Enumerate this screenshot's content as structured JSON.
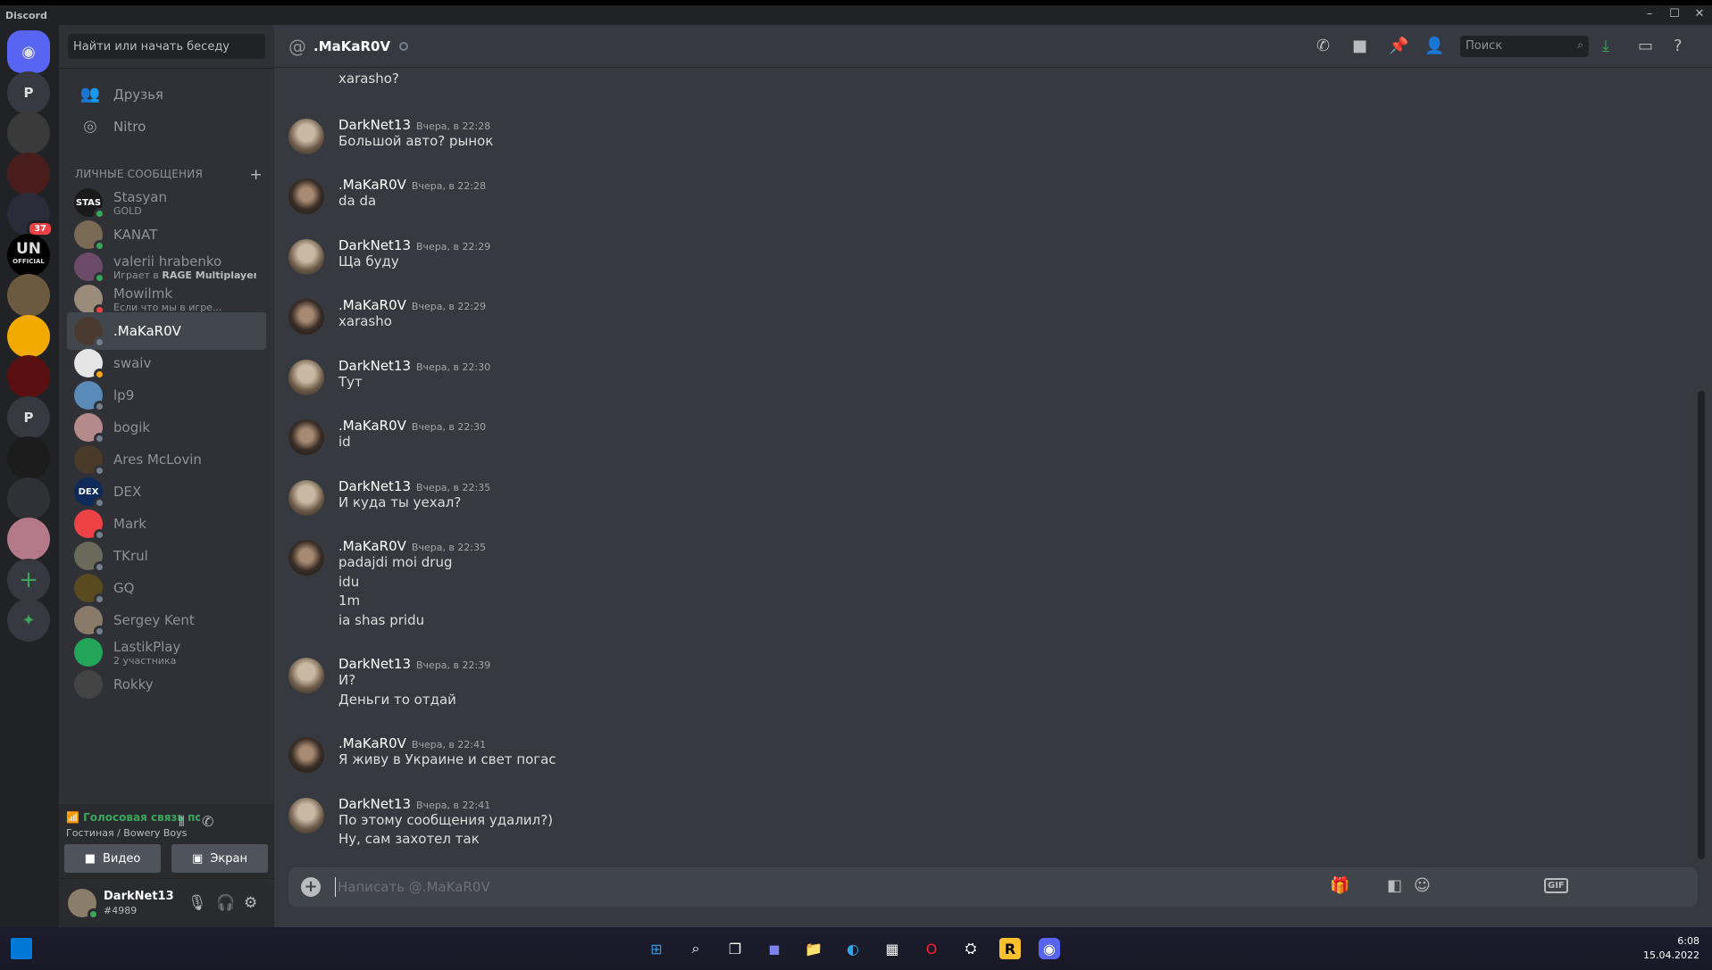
{
  "window": {
    "app_name": "Discord"
  },
  "guilds": [
    {
      "label": "",
      "kind": "home"
    },
    {
      "label": "P",
      "kind": "letter"
    },
    {
      "label": "",
      "kind": "image"
    },
    {
      "label": "",
      "kind": "image"
    },
    {
      "label": "",
      "kind": "image",
      "badge": "37"
    },
    {
      "label": "UN",
      "sub": "OFFICIAL",
      "kind": "text"
    },
    {
      "label": "",
      "kind": "image"
    },
    {
      "label": "",
      "kind": "image"
    },
    {
      "label": "",
      "kind": "image"
    },
    {
      "label": "P",
      "kind": "letter"
    },
    {
      "label": "",
      "kind": "image"
    },
    {
      "label": "",
      "kind": "image"
    },
    {
      "label": "",
      "kind": "image"
    },
    {
      "label": "+",
      "kind": "add"
    },
    {
      "label": "",
      "kind": "explore"
    }
  ],
  "dm_sidebar": {
    "search_placeholder": "Найти или начать беседу",
    "nav": [
      {
        "label": "Друзья",
        "icon": "friends-icon"
      },
      {
        "label": "Nitro",
        "icon": "nitro-icon"
      }
    ],
    "section_title": "ЛИЧНЫЕ СООБЩЕНИЯ",
    "section_add": "+",
    "dms": [
      {
        "name": "Stasyan",
        "sub": "GOLD",
        "status": "online",
        "avatar_text": "STAS"
      },
      {
        "name": "KANAT",
        "sub": "",
        "status": "online",
        "avatar_text": ""
      },
      {
        "name": "valerii hrabenko",
        "sub_prefix": "Играет в ",
        "sub": "RAGE Multiplayer",
        "status": "online",
        "avatar_text": ""
      },
      {
        "name": "Mowilmk",
        "sub": "Если что мы в игре...",
        "status": "dnd",
        "avatar_text": ""
      },
      {
        "name": ".MaKaR0V",
        "sub": "",
        "status": "offline",
        "avatar_text": "",
        "active": true
      },
      {
        "name": "swaiv",
        "sub": "",
        "status": "idle",
        "avatar_text": ""
      },
      {
        "name": "lp9",
        "sub": "",
        "status": "offline",
        "avatar_text": ""
      },
      {
        "name": "bogik",
        "sub": "",
        "status": "offline",
        "avatar_text": ""
      },
      {
        "name": "Ares McLovin",
        "sub": "",
        "status": "offline",
        "avatar_text": ""
      },
      {
        "name": "DEX",
        "sub": "",
        "status": "offline",
        "avatar_text": "DEX"
      },
      {
        "name": "Mark",
        "sub": "",
        "status": "offline",
        "avatar_text": ""
      },
      {
        "name": "TKrul",
        "sub": "",
        "status": "offline",
        "avatar_text": ""
      },
      {
        "name": "GQ",
        "sub": "",
        "status": "offline",
        "avatar_text": ""
      },
      {
        "name": "Sergey Kent",
        "sub": "",
        "status": "offline",
        "avatar_text": ""
      },
      {
        "name": "LastikPlay",
        "sub": "2 участника",
        "status": "none",
        "avatar_text": ""
      },
      {
        "name": "Rokky",
        "sub": "",
        "status": "none",
        "avatar_text": ""
      }
    ]
  },
  "voice": {
    "status": "Голосовая связь подк",
    "channel": "Гостиная / Bowery Boys",
    "video_label": "Видео",
    "screen_label": "Экран"
  },
  "user": {
    "name": "DarkNet13",
    "tag": "#4989"
  },
  "chat": {
    "title": ".MaKaR0V",
    "search_placeholder": "Поиск",
    "input_placeholder": "Написать @.MaKaR0V",
    "messages": [
      {
        "continuation": true,
        "lines": [
          "xarasho?"
        ]
      },
      {
        "author": "DarkNet13",
        "time": "Вчера, в 22:28",
        "lines": [
          "Большой авто? рынок"
        ]
      },
      {
        "author": ".MaKaR0V",
        "time": "Вчера, в 22:28",
        "lines": [
          "da da"
        ]
      },
      {
        "author": "DarkNet13",
        "time": "Вчера, в 22:29",
        "lines": [
          "Ща буду"
        ]
      },
      {
        "author": ".MaKaR0V",
        "time": "Вчера, в 22:29",
        "lines": [
          "xarasho"
        ]
      },
      {
        "author": "DarkNet13",
        "time": "Вчера, в 22:30",
        "lines": [
          "Тут"
        ]
      },
      {
        "author": ".MaKaR0V",
        "time": "Вчера, в 22:30",
        "lines": [
          "id"
        ]
      },
      {
        "author": "DarkNet13",
        "time": "Вчера, в 22:35",
        "lines": [
          "И куда ты уехал?"
        ]
      },
      {
        "author": ".MaKaR0V",
        "time": "Вчера, в 22:35",
        "lines": [
          "padajdi moi drug",
          "idu",
          "1m",
          "ia shas pridu"
        ]
      },
      {
        "author": "DarkNet13",
        "time": "Вчера, в 22:39",
        "lines": [
          "И?",
          "Деньги то отдай"
        ]
      },
      {
        "author": ".MaKaR0V",
        "time": "Вчера, в 22:41",
        "lines": [
          "Я живу в Украине и свет погас"
        ]
      },
      {
        "author": "DarkNet13",
        "time": "Вчера, в 22:41",
        "lines": [
          "По этому сообщения удалил?)",
          "Ну, сам захотел так"
        ]
      }
    ]
  },
  "composer": {
    "gif_label": "GIF"
  },
  "taskbar": {
    "time": "6:08",
    "date": "15.04.2022"
  },
  "colors": {
    "accent": "#5865f2",
    "online": "#3ba55c",
    "dnd": "#ed4245",
    "idle": "#faa81a",
    "offline": "#747f8d"
  }
}
